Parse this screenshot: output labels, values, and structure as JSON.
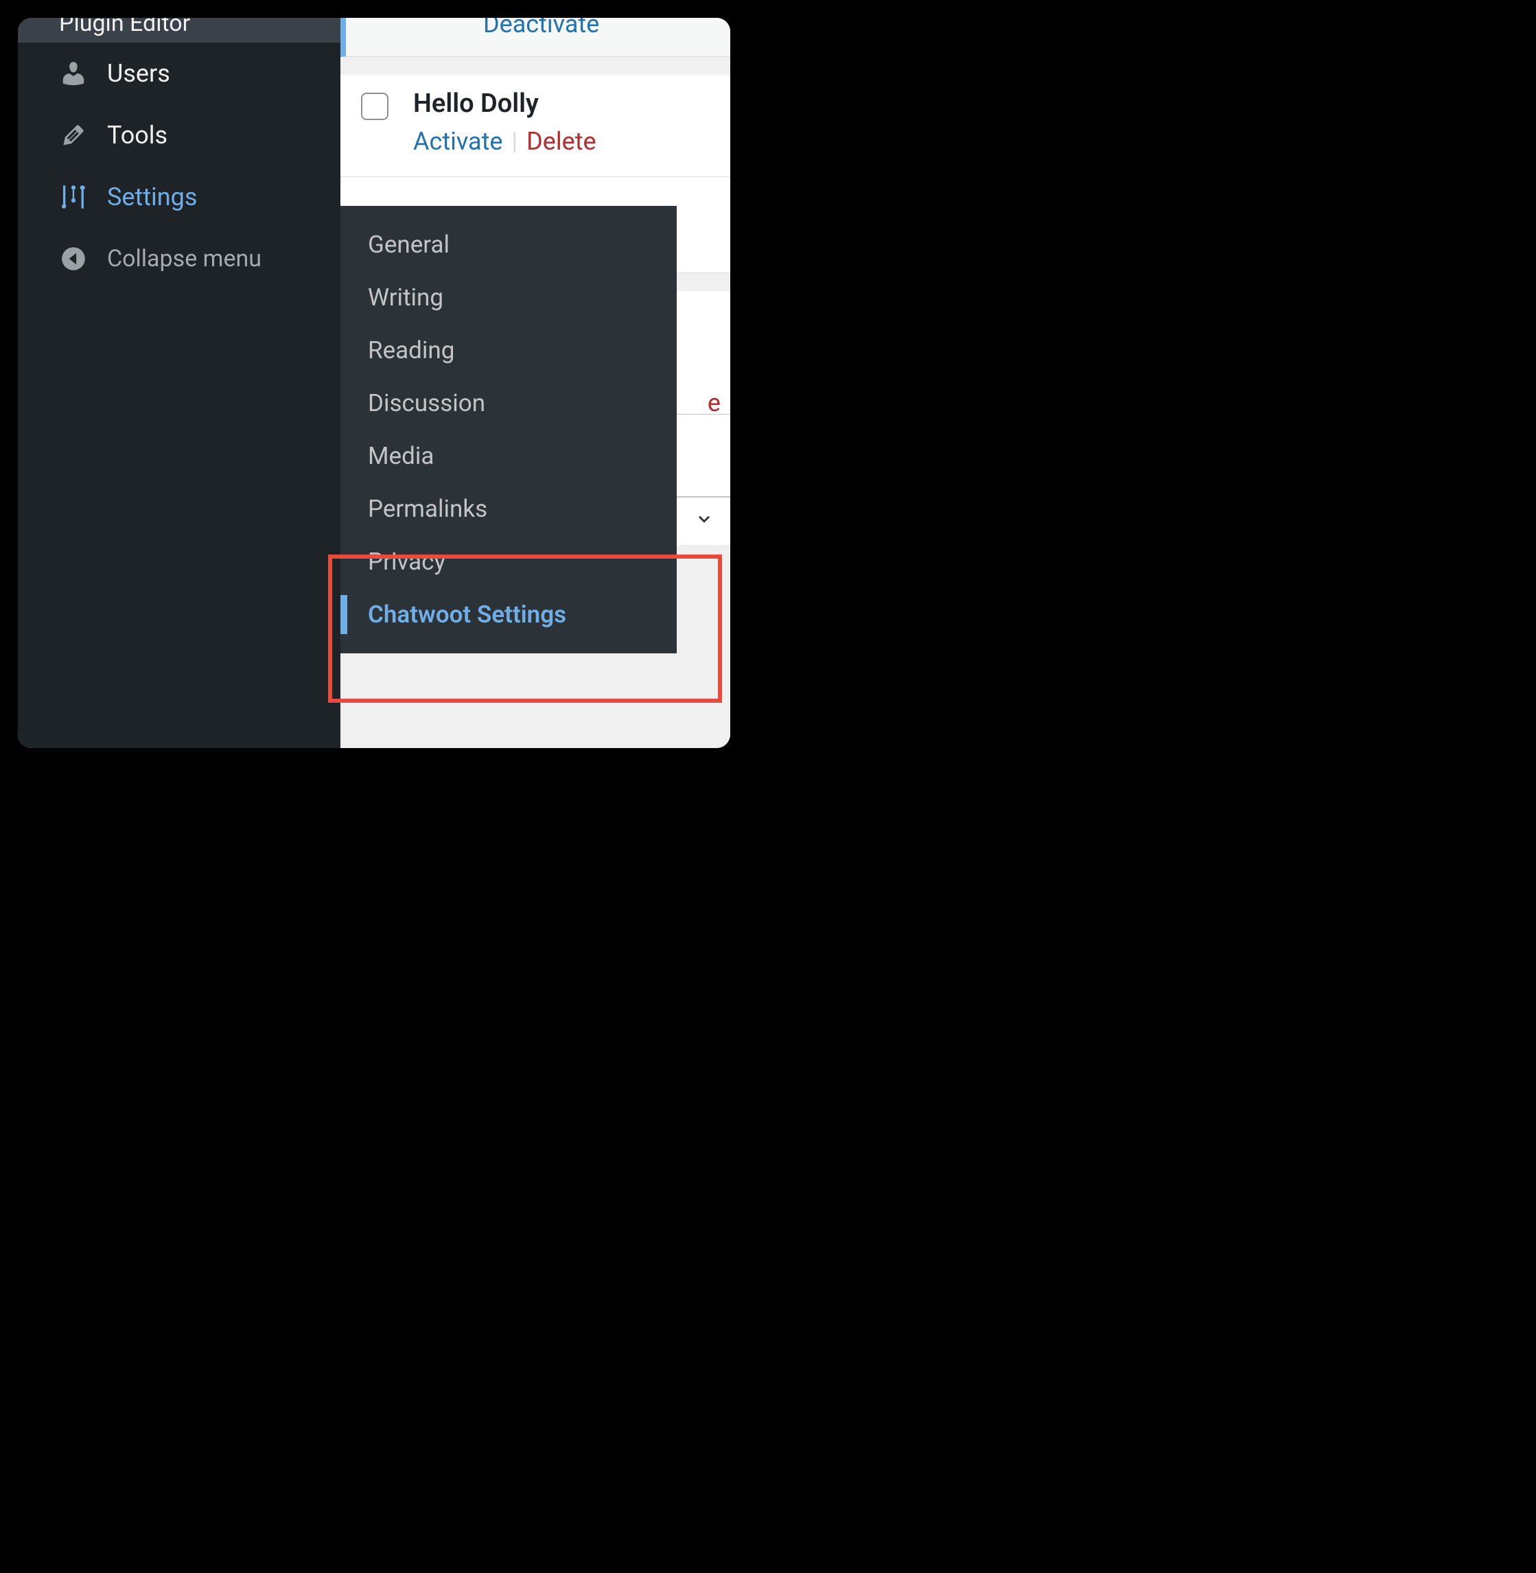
{
  "sidebar": {
    "top_label": "Plugin Editor",
    "items": [
      {
        "label": "Users"
      },
      {
        "label": "Tools"
      },
      {
        "label": "Settings"
      },
      {
        "label": "Collapse menu"
      }
    ]
  },
  "plugins": {
    "row1": {
      "action": "Deactivate"
    },
    "row2": {
      "name": "Hello Dolly",
      "activate": "Activate",
      "delete": "Delete"
    }
  },
  "partial_text": "e",
  "settings_flyout": {
    "items": [
      "General",
      "Writing",
      "Reading",
      "Discussion",
      "Media",
      "Permalinks",
      "Privacy",
      "Chatwoot Settings"
    ]
  }
}
